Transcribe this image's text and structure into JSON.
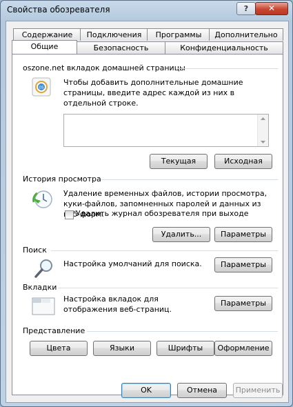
{
  "window": {
    "title": "Свойства обозревателя",
    "help_label": "?",
    "close_label": "✕"
  },
  "tabs": {
    "row1": [
      "Содержание",
      "Подключения",
      "Программы",
      "Дополнительно"
    ],
    "row2": [
      "Общие",
      "Безопасность",
      "Конфиденциальность"
    ],
    "selected": "Общие"
  },
  "home_page": {
    "heading": "oszone.net вкладок домашней страницы",
    "description": "Чтобы добавить дополнительные домашние страницы, введите адрес каждой из них в отдельной строке.",
    "value": "",
    "current_label": "Текущая",
    "default_label": "Исходная"
  },
  "history": {
    "heading": "История просмотра",
    "description": "Удаление временных файлов, истории просмотра, куки-файлов, запомненных паролей и данных из веб-форм.",
    "checkbox_label": "Удалить журнал обозревателя при выходе",
    "checkbox_checked": false,
    "delete_label": "Удалить...",
    "settings_label": "Параметры"
  },
  "search": {
    "heading": "Поиск",
    "description": "Настройка умолчаний для поиска.",
    "settings_label": "Параметры"
  },
  "tabs_section": {
    "heading": "Вкладки",
    "description": "Настройка вкладок для отображения веб-страниц.",
    "settings_label": "Параметры"
  },
  "appearance": {
    "heading": "Представление",
    "colors_label": "Цвета",
    "languages_label": "Языки",
    "fonts_label": "Шрифты",
    "accessibility_label": "Оформление"
  },
  "footer": {
    "ok_label": "OK",
    "cancel_label": "Отмена",
    "apply_label": "Применить"
  }
}
